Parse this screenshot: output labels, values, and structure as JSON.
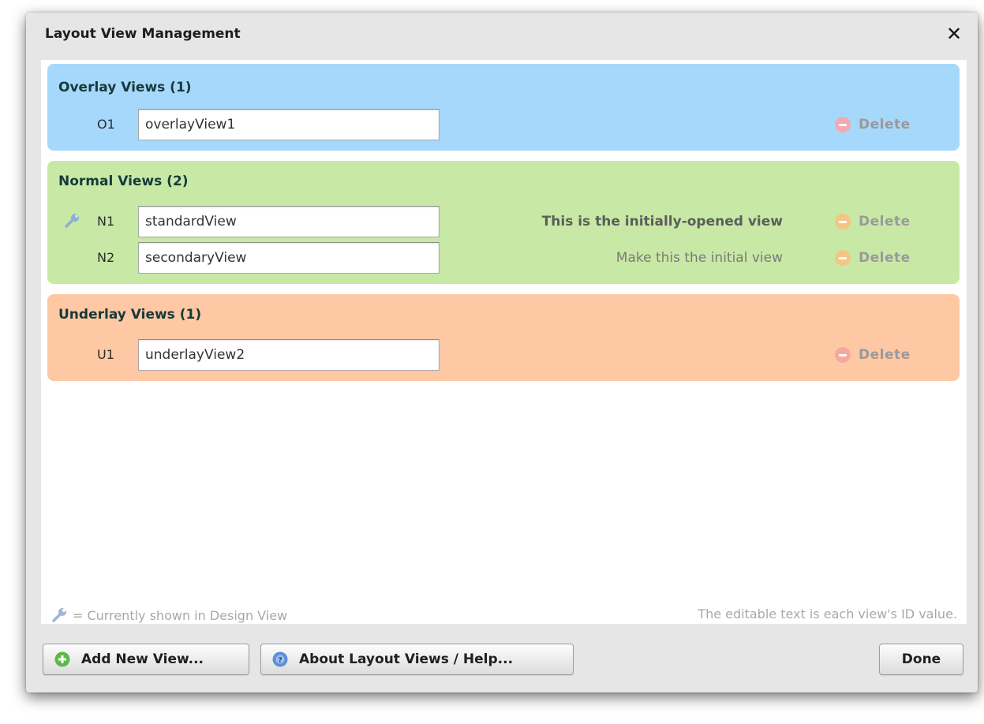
{
  "dialog": {
    "title": "Layout View Management"
  },
  "groups": {
    "overlay": {
      "title": "Overlay Views (1)",
      "rows": [
        {
          "id": "O1",
          "value": "overlayView1",
          "delete_label": "Delete"
        }
      ]
    },
    "normal": {
      "title": "Normal Views (2)",
      "rows": [
        {
          "id": "N1",
          "value": "standardView",
          "initial_text": "This is the initially-opened view",
          "delete_label": "Delete"
        },
        {
          "id": "N2",
          "value": "secondaryView",
          "initial_text": "Make this the initial view",
          "delete_label": "Delete"
        }
      ]
    },
    "underlay": {
      "title": "Underlay Views (1)",
      "rows": [
        {
          "id": "U1",
          "value": "underlayView2",
          "delete_label": "Delete"
        }
      ]
    }
  },
  "legend": {
    "left": "= Currently shown in Design View",
    "right": "The editable text is each view's ID value."
  },
  "buttons": {
    "add": "Add New View...",
    "help": "About Layout Views / Help...",
    "done": "Done"
  },
  "icons": {
    "close": "close-icon",
    "wrench": "wrench-icon",
    "delete": "minus-circle-icon",
    "add": "plus-circle-icon",
    "help": "question-circle-icon"
  },
  "colors": {
    "overlay_bg": "#a6d8fb",
    "normal_bg": "#c8e9a6",
    "underlay_bg": "#fec8a4",
    "overlay_delete": "#f3a9b1",
    "normal_delete": "#f4c583",
    "underlay_delete": "#f6a89e",
    "add_icon": "#5dba48",
    "help_icon": "#5b8fd8"
  }
}
